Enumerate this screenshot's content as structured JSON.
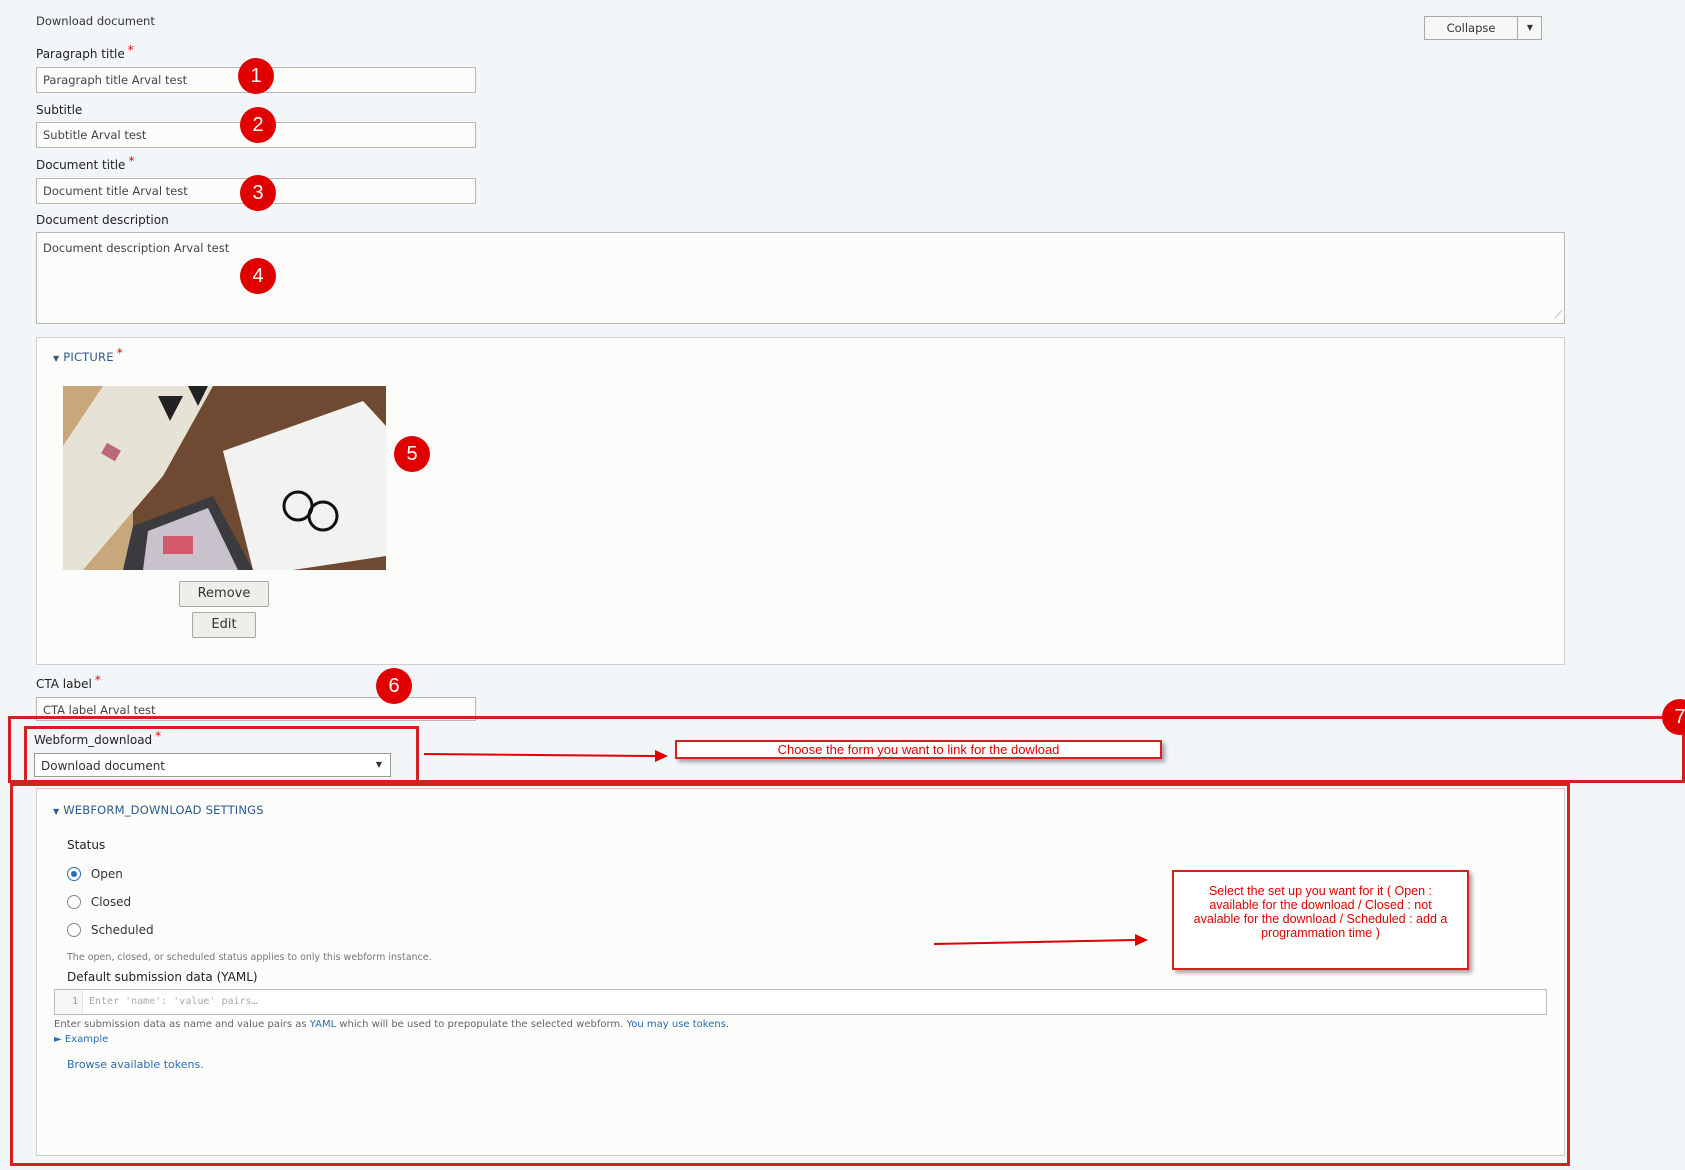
{
  "header": {
    "paragraph_type": "Download document",
    "collapse_label": "Collapse"
  },
  "fields": {
    "paragraph_title": {
      "label": "Paragraph title",
      "required_mark": "*",
      "value": "Paragraph title Arval test"
    },
    "subtitle": {
      "label": "Subtitle",
      "value": "Subtitle Arval test"
    },
    "document_title": {
      "label": "Document title",
      "required_mark": "*",
      "value": "Document title Arval test"
    },
    "document_description": {
      "label": "Document description",
      "value": "Document description Arval test"
    }
  },
  "picture": {
    "summary": "PICTURE",
    "required_mark": "*",
    "remove_label": "Remove",
    "edit_label": "Edit"
  },
  "cta": {
    "label": "CTA label",
    "required_mark": "*",
    "value": "CTA label Arval test"
  },
  "webform": {
    "label": "Webform_download",
    "required_mark": "*",
    "selected": "Download document"
  },
  "settings": {
    "summary": "WEBFORM_DOWNLOAD SETTINGS",
    "status_label": "Status",
    "options": [
      {
        "label": "Open",
        "checked": true
      },
      {
        "label": "Closed",
        "checked": false
      },
      {
        "label": "Scheduled",
        "checked": false
      }
    ],
    "status_help": "The open, closed, or scheduled status applies to only this webform instance.",
    "default_data_label": "Default submission data (YAML)",
    "line_number": "1",
    "code_placeholder": "Enter 'name': 'value' pairs…",
    "help_prefix": "Enter submission data as name and value pairs as ",
    "help_yaml_link": "YAML",
    "help_middle": " which will be used to prepopulate the selected webform. ",
    "help_tokens_link": "You may use tokens.",
    "example_label": "► Example",
    "browse_tokens": "Browse available tokens."
  },
  "annotations": {
    "badges": [
      "1",
      "2",
      "3",
      "4",
      "5",
      "6",
      "7"
    ],
    "note_form": "Choose the form you want to link for the dowload",
    "note_status": "Select the set up you want for it ( Open : available  for the download / Closed : not avalable for the download / Scheduled : add a programmation time )",
    "color_red": "#e00000"
  }
}
